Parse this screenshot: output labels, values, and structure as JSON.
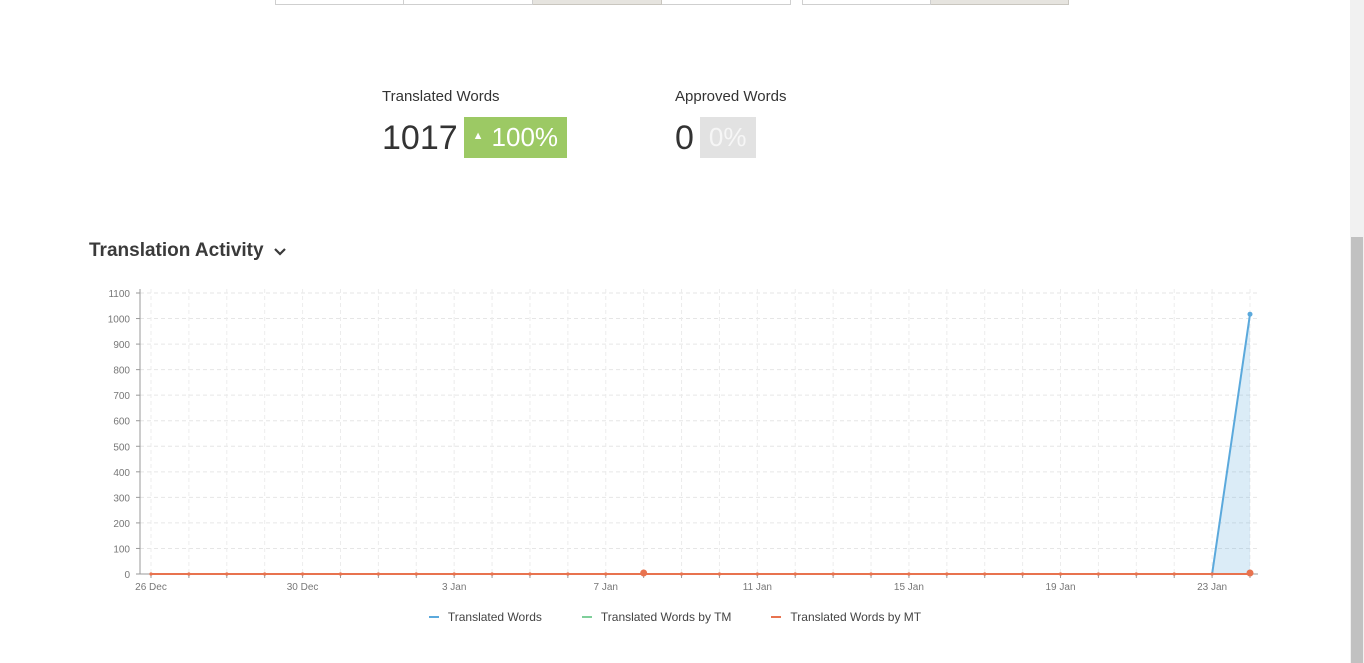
{
  "stats": {
    "translated": {
      "label": "Translated Words",
      "value": "1017",
      "change": "100%",
      "arrow": "▲",
      "color": "#9cc964"
    },
    "approved": {
      "label": "Approved Words",
      "value": "0",
      "change": "0%"
    }
  },
  "section": {
    "title": "Translation Activity",
    "chevron": "chevron-down-icon"
  },
  "legend": [
    {
      "label": "Translated Words",
      "color": "#5ba9dc"
    },
    {
      "label": "Translated Words by TM",
      "color": "#7fcf9a"
    },
    {
      "label": "Translated Words by MT",
      "color": "#e8734f"
    }
  ],
  "chart_data": {
    "type": "line",
    "x_start": "2015-12-26",
    "x_end": "2016-01-24",
    "xticks": [
      "26 Dec",
      "30 Dec",
      "3 Jan",
      "7 Jan",
      "11 Jan",
      "15 Jan",
      "19 Jan",
      "23 Jan"
    ],
    "yticks": [
      0,
      100,
      200,
      300,
      400,
      500,
      600,
      700,
      800,
      900,
      1000,
      1100
    ],
    "ylim": [
      0,
      1100
    ],
    "series": [
      {
        "name": "Translated Words",
        "color": "#5ba9dc",
        "area": true,
        "points": [
          [
            "2016-01-23",
            0
          ],
          [
            "2016-01-24",
            1017
          ]
        ]
      },
      {
        "name": "Translated Words by TM",
        "color": "#7fcf9a",
        "area": false,
        "points": []
      },
      {
        "name": "Translated Words by MT",
        "color": "#e8734f",
        "area": false,
        "points": [
          [
            "2015-12-26",
            0
          ],
          [
            "2016-01-24",
            0
          ]
        ],
        "highlight": [
          [
            "2016-01-08",
            0
          ],
          [
            "2016-01-24",
            0
          ]
        ]
      }
    ],
    "grid": true
  }
}
